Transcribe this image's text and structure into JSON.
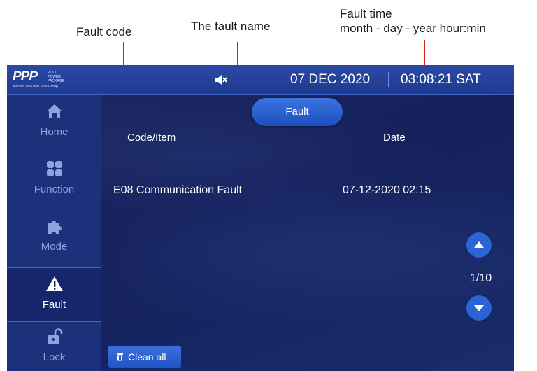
{
  "annotations": {
    "fault_code": "Fault code",
    "fault_name": "The fault name",
    "fault_time_line1": "Fault time",
    "fault_time_line2": "month - day - year hour:min"
  },
  "header": {
    "logo_mark": "PPP",
    "logo_text": [
      "POOL",
      "POWER",
      "PACKAGE"
    ],
    "logo_sub": "A brand of Fulton Pool Group",
    "date": "07 DEC 2020",
    "time": "03:08:21 SAT",
    "mute_icon": "speaker-mute-icon"
  },
  "sidebar": {
    "items": [
      {
        "label": "Home",
        "icon": "home-icon"
      },
      {
        "label": "Function",
        "icon": "function-grid-icon"
      },
      {
        "label": "Mode",
        "icon": "puzzle-icon"
      },
      {
        "label": "Fault",
        "icon": "warning-icon",
        "active": true
      },
      {
        "label": "Lock",
        "icon": "unlock-icon"
      }
    ]
  },
  "main": {
    "tab_label": "Fault",
    "columns": {
      "code": "Code/Item",
      "date": "Date"
    },
    "rows": [
      {
        "code_item": "E08 Communication Fault",
        "date": "07-12-2020 02:15"
      }
    ],
    "pager": "1/10",
    "clean_label": "Clean all"
  },
  "colors": {
    "accent": "#2a64d6",
    "background": "#14205a",
    "arrow": "#e0201b"
  }
}
